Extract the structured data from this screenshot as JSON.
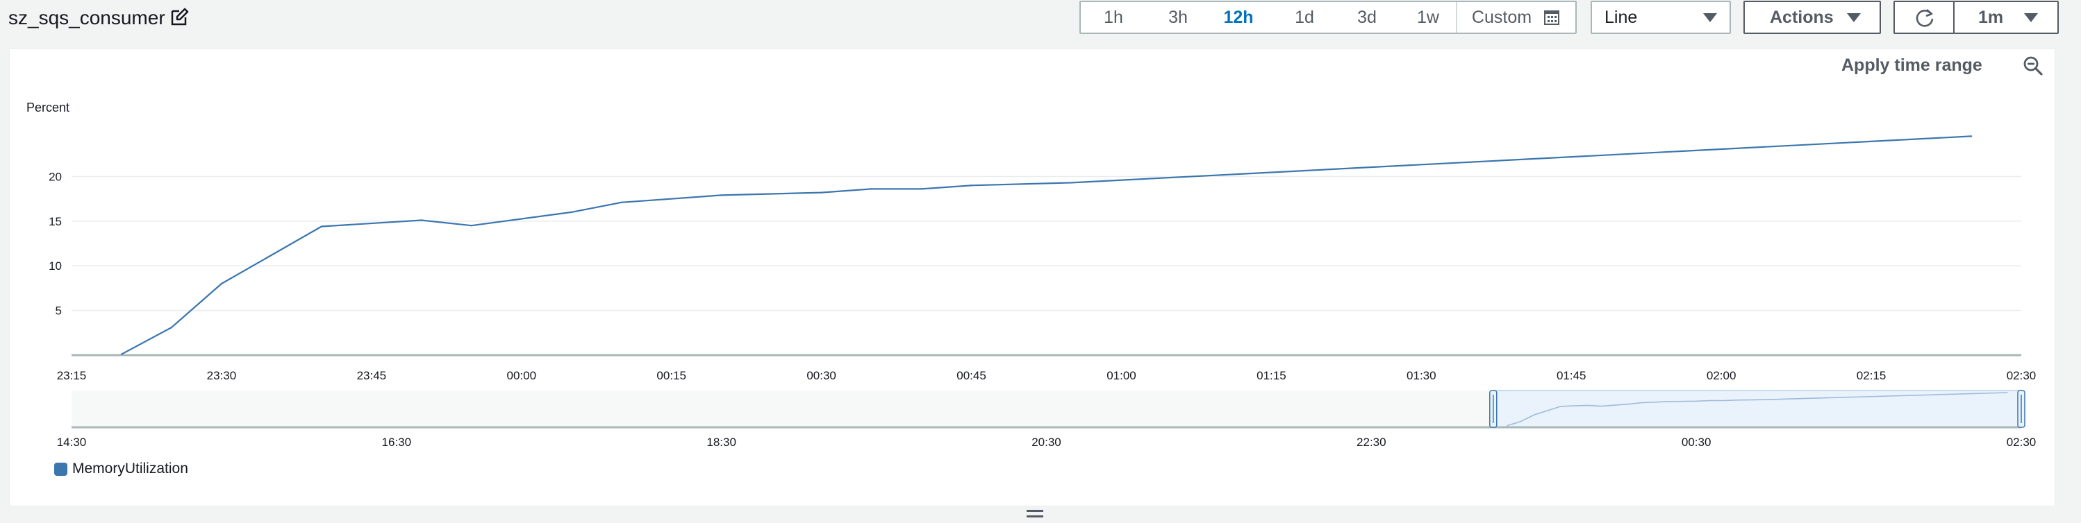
{
  "header": {
    "title": "sz_sqs_consumer",
    "time_ranges": [
      "1h",
      "3h",
      "12h",
      "1d",
      "3d",
      "1w"
    ],
    "selected_range": "12h",
    "custom_label": "Custom",
    "view_type": "Line",
    "actions_label": "Actions",
    "refresh_interval": "1m"
  },
  "panel": {
    "apply_label": "Apply time range",
    "legend_label": "MemoryUtilization",
    "legend_color": "#3b76af"
  },
  "chart_data": {
    "type": "line",
    "ylabel": "Percent",
    "yticks": [
      5,
      10,
      15,
      20
    ],
    "ylim": [
      0,
      25
    ],
    "x_tick_labels": [
      "23:15",
      "23:30",
      "23:45",
      "00:00",
      "00:15",
      "00:30",
      "00:45",
      "01:00",
      "01:15",
      "01:30",
      "01:45",
      "02:00",
      "02:15",
      "02:30"
    ],
    "x_start": "23:15",
    "x_end": "02:30",
    "grid": true,
    "series": [
      {
        "name": "MemoryUtilization",
        "color": "#3b76af",
        "x": [
          "23:20",
          "23:25",
          "23:30",
          "23:40",
          "23:50",
          "23:55",
          "00:05",
          "00:10",
          "00:20",
          "00:30",
          "00:35",
          "00:40",
          "00:45",
          "00:55",
          "02:25"
        ],
        "values": [
          0.1,
          3.1,
          8.0,
          14.4,
          15.1,
          14.5,
          16.0,
          17.1,
          17.9,
          18.2,
          18.6,
          18.6,
          19.0,
          19.3,
          24.5
        ]
      }
    ],
    "overview": {
      "x_tick_labels": [
        "14:30",
        "16:30",
        "18:30",
        "20:30",
        "22:30",
        "00:30",
        "02:30"
      ],
      "x_start": "14:30",
      "x_end": "02:30",
      "selected_start": "23:15",
      "selected_end": "02:30"
    }
  }
}
